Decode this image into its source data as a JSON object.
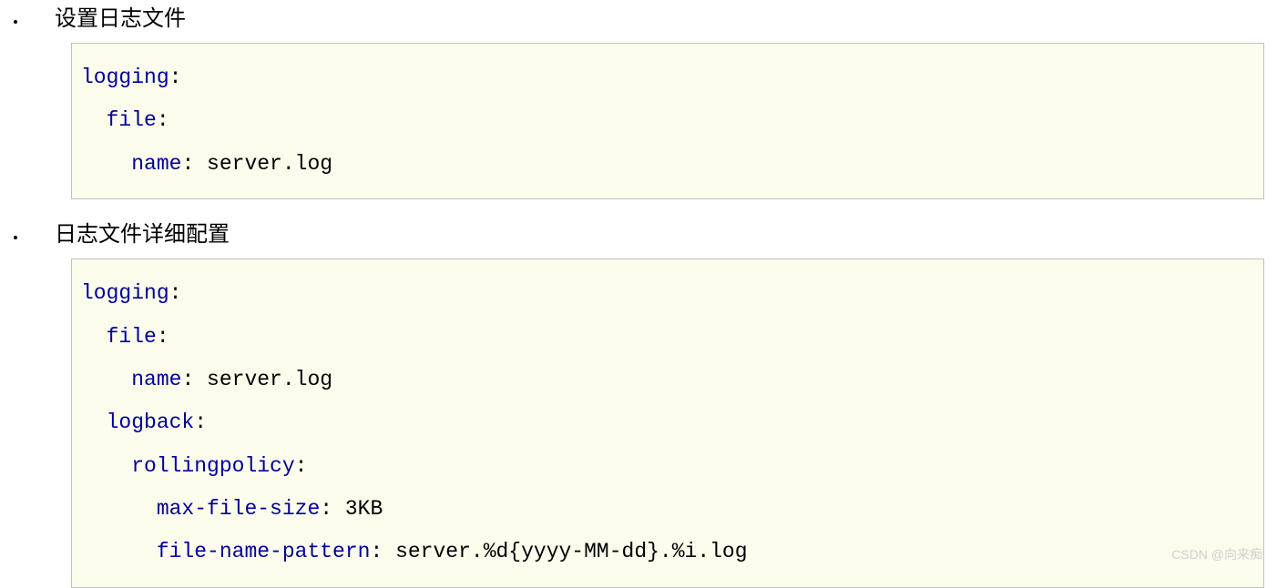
{
  "sections": [
    {
      "title": "设置日志文件",
      "code_html": "<span class='key'>logging</span>:\n  <span class='key'>file</span>:\n    <span class='key'>name</span>: <span class='val'>server.log</span>"
    },
    {
      "title": "日志文件详细配置",
      "code_html": "<span class='key'>logging</span>:\n  <span class='key'>file</span>:\n    <span class='key'>name</span>: <span class='val'>server.log</span>\n  <span class='key'>logback</span>:\n    <span class='key'>rollingpolicy</span>:\n      <span class='key'>max-file-size</span>: <span class='val'>3KB</span>\n      <span class='key'>file-name-pattern</span>: <span class='val'>server.%d{yyyy-MM-dd}.%i.log</span>"
    }
  ],
  "watermark": "CSDN @向来痴"
}
